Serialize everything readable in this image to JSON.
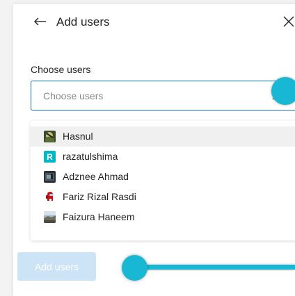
{
  "header": {
    "title": "Add users",
    "back_icon": "arrow-left-icon",
    "close_icon": "close-icon"
  },
  "field": {
    "label": "Choose users",
    "value": "",
    "placeholder": "Choose users",
    "clear_icon": "close-icon"
  },
  "dropdown": {
    "items": [
      {
        "label": "Hasnul",
        "avatar": "photo-avatar",
        "highlighted": true
      },
      {
        "label": "razatulshima",
        "avatar": "letter-avatar",
        "initial": "R",
        "highlighted": false
      },
      {
        "label": "Adznee Ahmad",
        "avatar": "photo-avatar",
        "highlighted": false
      },
      {
        "label": "Fariz Rizal Rasdi",
        "avatar": "character-avatar",
        "highlighted": false
      },
      {
        "label": "Faizura Haneem",
        "avatar": "photo-avatar",
        "highlighted": false
      }
    ]
  },
  "footer": {
    "add_label": "Add users",
    "add_disabled": true
  },
  "colors": {
    "accent": "#0f6cbd",
    "annotation": "#18b8d4",
    "button_disabled": "#cce4f6",
    "letter_avatar": "#00b7c3"
  }
}
